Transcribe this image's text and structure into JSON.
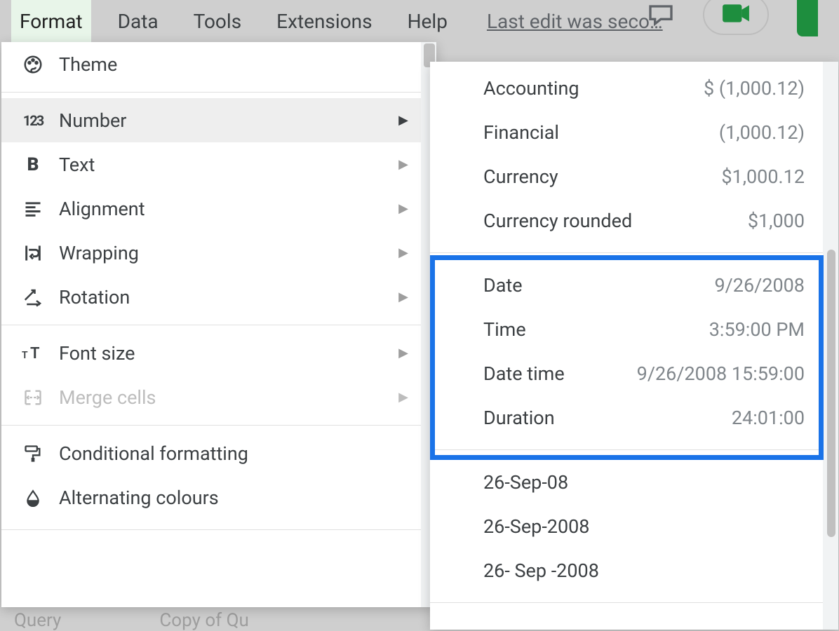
{
  "menubar": {
    "format": "Format",
    "data": "Data",
    "tools": "Tools",
    "extensions": "Extensions",
    "help": "Help",
    "last_edit": "Last edit was seco…"
  },
  "format_menu": {
    "theme": "Theme",
    "number": "Number",
    "text": "Text",
    "alignment": "Alignment",
    "wrapping": "Wrapping",
    "rotation": "Rotation",
    "font_size": "Font size",
    "merge_cells": "Merge cells",
    "conditional_formatting": "Conditional formatting",
    "alternating_colours": "Alternating colours"
  },
  "number_menu": {
    "accounting": {
      "label": "Accounting",
      "example": "$ (1,000.12)"
    },
    "financial": {
      "label": "Financial",
      "example": "(1,000.12)"
    },
    "currency": {
      "label": "Currency",
      "example": "$1,000.12"
    },
    "currency_rounded": {
      "label": "Currency rounded",
      "example": "$1,000"
    },
    "date": {
      "label": "Date",
      "example": "9/26/2008"
    },
    "time": {
      "label": "Time",
      "example": "3:59:00 PM"
    },
    "date_time": {
      "label": "Date time",
      "example": "9/26/2008 15:59:00"
    },
    "duration": {
      "label": "Duration",
      "example": "24:01:00"
    },
    "custom1": {
      "label": "26-Sep-08"
    },
    "custom2": {
      "label": "26-Sep-2008"
    },
    "custom3": {
      "label": "26- Sep -2008"
    }
  }
}
